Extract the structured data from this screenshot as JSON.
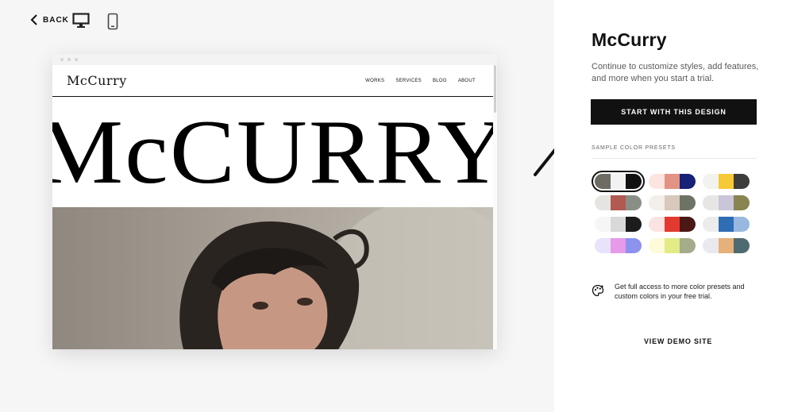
{
  "topbar": {
    "back_label": "BACK",
    "desktop_icon": "desktop-icon",
    "mobile_icon": "mobile-icon"
  },
  "preview": {
    "logo": "McCurry",
    "nav": [
      "WORKS",
      "SERVICES",
      "BLOG",
      "ABOUT"
    ],
    "hero_text": "McCURRY"
  },
  "panel": {
    "title": "McCurry",
    "description": "Continue to customize styles, add features, and more when you start a trial.",
    "cta_label": "START WITH THIS DESIGN",
    "presets_label": "SAMPLE COLOR PRESETS",
    "presets": [
      {
        "colors": [
          "#6e6a64",
          "#f2f2f2",
          "#111111"
        ],
        "selected": true
      },
      {
        "colors": [
          "#fbe5de",
          "#e39383",
          "#162177"
        ],
        "selected": false
      },
      {
        "colors": [
          "#f2f2ef",
          "#f6c936",
          "#3d3d3b"
        ],
        "selected": false
      },
      {
        "colors": [
          "#e6e4e1",
          "#b05a52",
          "#8a8f86"
        ],
        "selected": false
      },
      {
        "colors": [
          "#f3efea",
          "#d8c9bc",
          "#6e7465"
        ],
        "selected": false
      },
      {
        "colors": [
          "#e7e6e4",
          "#c9c6d9",
          "#8a8450"
        ],
        "selected": false
      },
      {
        "colors": [
          "#f6f6f6",
          "#d9d9d9",
          "#1c1c1c"
        ],
        "selected": false
      },
      {
        "colors": [
          "#fbe3e2",
          "#e23a2e",
          "#4a1915"
        ],
        "selected": false
      },
      {
        "colors": [
          "#ececec",
          "#2f6db4",
          "#99b8df"
        ],
        "selected": false
      },
      {
        "colors": [
          "#e9e2fb",
          "#e69ae9",
          "#8c92ee"
        ],
        "selected": false
      },
      {
        "colors": [
          "#fdfbd8",
          "#e2eb86",
          "#a4ac8b"
        ],
        "selected": false
      },
      {
        "colors": [
          "#e9e9ee",
          "#e6b07a",
          "#4f6b72"
        ],
        "selected": false
      }
    ],
    "note": "Get full access to more color presets and custom colors in your free trial.",
    "note_icon": "palette-icon",
    "demo_label": "VIEW DEMO SITE"
  },
  "colors": {
    "accent": "#111111",
    "panel_bg": "#ffffff",
    "page_bg": "#f6f6f6"
  }
}
